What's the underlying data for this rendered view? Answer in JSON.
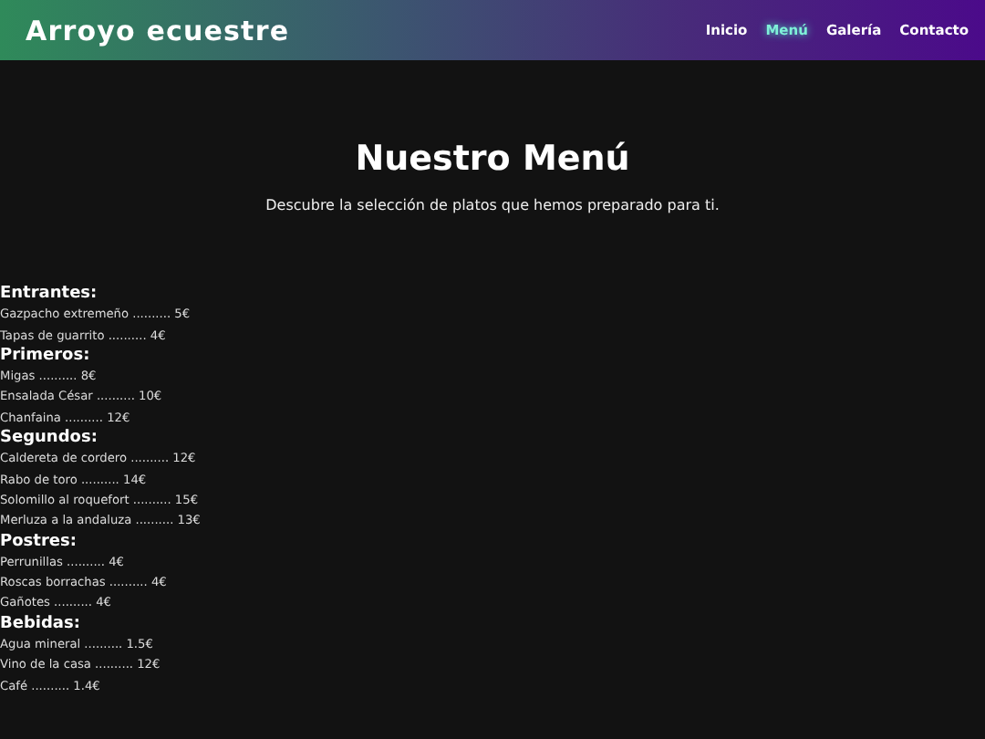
{
  "header": {
    "logo": "Arroyo ecuestre",
    "nav": [
      {
        "label": "Inicio",
        "selected": false
      },
      {
        "label": "Menú",
        "selected": true
      },
      {
        "label": "Galería",
        "selected": false
      },
      {
        "label": "Contacto",
        "selected": false
      }
    ]
  },
  "hero": {
    "title": "Nuestro Menú",
    "subtitle": "Descubre la selección de platos que hemos preparado para ti."
  },
  "sections": [
    {
      "heading": "Entrantes:",
      "items": [
        "Gazpacho extremeño .......... 5€",
        "Tapas de guarrito .......... 4€"
      ]
    },
    {
      "heading": "Primeros:",
      "items": [
        "Migas .......... 8€",
        "Ensalada César .......... 10€",
        "Chanfaina .......... 12€"
      ]
    },
    {
      "heading": "Segundos:",
      "items": [
        "Caldereta de cordero .......... 12€",
        "Rabo de toro .......... 14€",
        "Solomillo al roquefort .......... 15€",
        "Merluza a la andaluza .......... 13€"
      ]
    },
    {
      "heading": "Postres:",
      "items": [
        "Perrunillas .......... 4€",
        "Roscas borrachas .......... 4€",
        "Gañotes .......... 4€"
      ]
    },
    {
      "heading": "Bebidas:",
      "items": [
        "Agua mineral .......... 1.5€",
        "Vino de la casa .......... 12€",
        "Café .......... 1.4€"
      ]
    }
  ]
}
